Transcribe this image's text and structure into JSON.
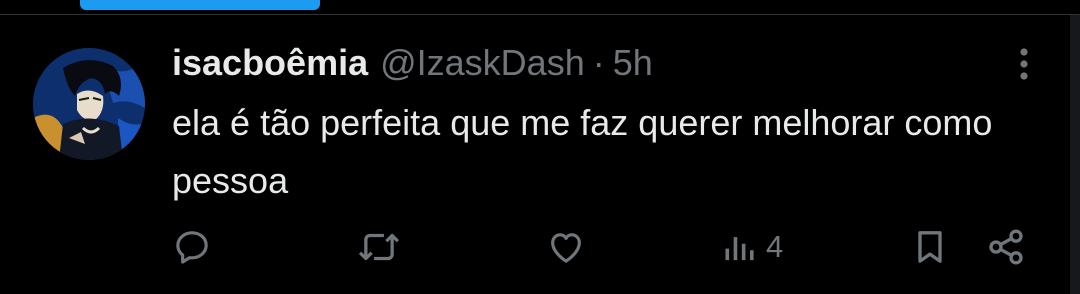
{
  "tweet": {
    "display_name": "isacboêmia",
    "handle": "@IzaskDash",
    "separator": "·",
    "time": "5h",
    "text": "ela é tão perfeita que me faz querer melhorar como pessoa"
  },
  "actions": {
    "reply_icon": "reply-icon",
    "retweet_icon": "retweet-icon",
    "like_icon": "heart-icon",
    "views_icon": "views-icon",
    "views_count": "4",
    "bookmark_icon": "bookmark-icon",
    "share_icon": "share-icon"
  },
  "colors": {
    "background": "#000000",
    "text_primary": "#e7e9ea",
    "text_secondary": "#71767b",
    "accent": "#1d9bf0"
  }
}
